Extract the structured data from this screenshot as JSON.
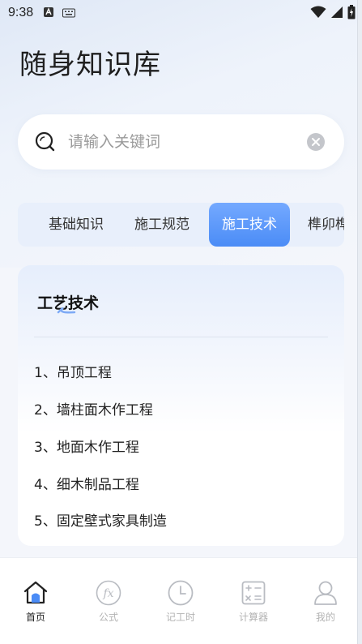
{
  "status_bar": {
    "time": "9:38"
  },
  "page": {
    "title": "随身知识库"
  },
  "search": {
    "placeholder": "请输入关键词"
  },
  "tabs": [
    {
      "label": "基础知识",
      "active": false
    },
    {
      "label": "施工规范",
      "active": false
    },
    {
      "label": "施工技术",
      "active": true
    },
    {
      "label": "榫卯榫",
      "active": false
    }
  ],
  "card": {
    "title": "工艺技术",
    "items": [
      "1、吊顶工程",
      "2、墙柱面木作工程",
      "3、地面木作工程",
      "4、细木制品工程",
      "5、固定壁式家具制造"
    ]
  },
  "nav": [
    {
      "label": "首页",
      "icon": "home-icon",
      "active": true
    },
    {
      "label": "公式",
      "icon": "formula-icon",
      "active": false
    },
    {
      "label": "记工时",
      "icon": "clock-icon",
      "active": false
    },
    {
      "label": "计算器",
      "icon": "calculator-icon",
      "active": false
    },
    {
      "label": "我的",
      "icon": "user-icon",
      "active": false
    }
  ],
  "colors": {
    "accent": "#4b8cf6",
    "tab_bg": "#e8effb",
    "background": "#f4f6fb"
  }
}
